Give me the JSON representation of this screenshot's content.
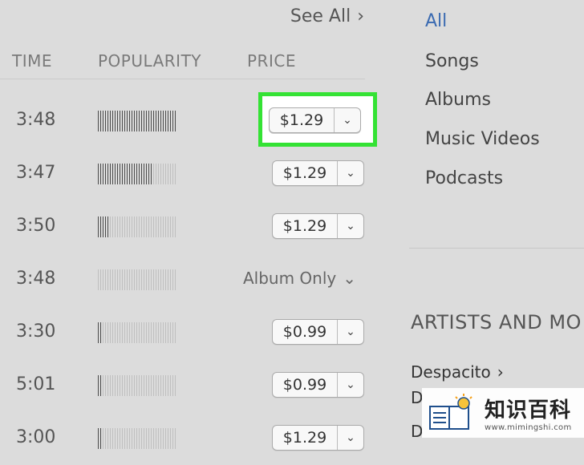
{
  "list": {
    "see_all": "See All",
    "headers": {
      "time": "TIME",
      "popularity": "POPULARITY",
      "price": "PRICE"
    },
    "rows": [
      {
        "time": "3:48",
        "popularity": 1.0,
        "price": "$1.29"
      },
      {
        "time": "3:47",
        "popularity": 0.68,
        "price": "$1.29"
      },
      {
        "time": "3:50",
        "popularity": 0.15,
        "price": "$1.29"
      },
      {
        "time": "3:48",
        "popularity": 0.0,
        "price": "Album Only"
      },
      {
        "time": "3:30",
        "popularity": 0.06,
        "price": "$0.99"
      },
      {
        "time": "5:01",
        "popularity": 0.06,
        "price": "$0.99"
      },
      {
        "time": "3:00",
        "popularity": 0.06,
        "price": "$1.29"
      }
    ]
  },
  "sidebar": {
    "categories": [
      "All",
      "Songs",
      "Albums",
      "Music Videos",
      "Podcasts"
    ],
    "active": "All",
    "section_title": "ARTISTS AND MO",
    "artist": "Despacito",
    "artist_sub": "D",
    "artist_sub2": "D"
  },
  "watermark": {
    "cn": "知识百科",
    "url": "www.mimingshi.com"
  },
  "colors": {
    "highlight": "#34e234",
    "accent": "#3a6ab1"
  }
}
